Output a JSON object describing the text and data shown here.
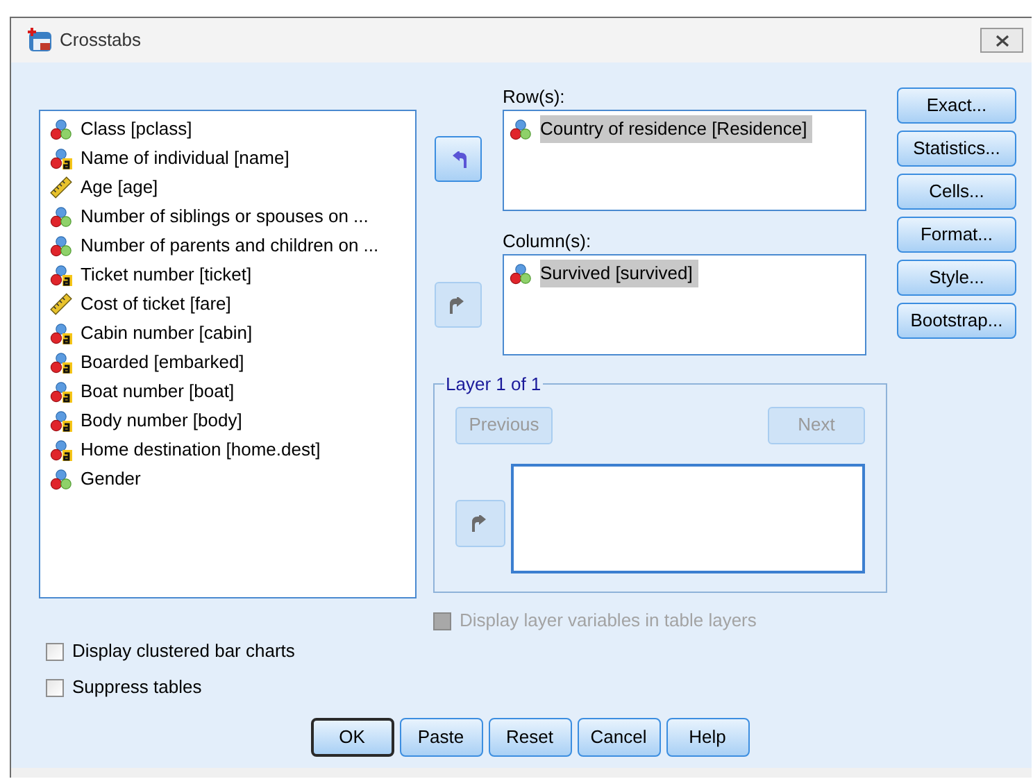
{
  "window": {
    "title": "Crosstabs"
  },
  "variables": [
    {
      "label": "Class [pclass]",
      "kind": "nominal"
    },
    {
      "label": "Name of individual [name]",
      "kind": "string"
    },
    {
      "label": "Age [age]",
      "kind": "scale"
    },
    {
      "label": "Number of siblings or spouses on ...",
      "kind": "nominal"
    },
    {
      "label": "Number of parents and children on ...",
      "kind": "nominal"
    },
    {
      "label": "Ticket number [ticket]",
      "kind": "string"
    },
    {
      "label": "Cost of ticket [fare]",
      "kind": "scale"
    },
    {
      "label": "Cabin number [cabin]",
      "kind": "string"
    },
    {
      "label": "Boarded [embarked]",
      "kind": "string"
    },
    {
      "label": "Boat number [boat]",
      "kind": "string"
    },
    {
      "label": "Body number [body]",
      "kind": "string"
    },
    {
      "label": "Home destination [home.dest]",
      "kind": "string"
    },
    {
      "label": "Gender",
      "kind": "nominal"
    }
  ],
  "targets": [
    {
      "label": "Row(s):",
      "move_disabled": false,
      "items": [
        {
          "label": "Country of residence [Residence]",
          "kind": "nominal",
          "selected": true
        }
      ]
    },
    {
      "label": "Column(s):",
      "move_disabled": true,
      "items": [
        {
          "label": "Survived [survived]",
          "kind": "nominal",
          "selected": true
        }
      ]
    }
  ],
  "layer": {
    "title": "Layer 1 of 1",
    "previous": {
      "label": "Previous",
      "disabled": true
    },
    "next": {
      "label": "Next",
      "disabled": true
    },
    "move_disabled": true
  },
  "layer_option": {
    "label": "Display layer variables in table layers",
    "checked": false,
    "disabled": true
  },
  "options": [
    {
      "label": "Display clustered bar charts",
      "checked": false,
      "disabled": false
    },
    {
      "label": "Suppress tables",
      "checked": false,
      "disabled": false
    }
  ],
  "side_buttons": [
    {
      "label": "Exact..."
    },
    {
      "label": "Statistics..."
    },
    {
      "label": "Cells..."
    },
    {
      "label": "Format..."
    },
    {
      "label": "Style..."
    },
    {
      "label": "Bootstrap..."
    }
  ],
  "dialog_buttons": [
    {
      "label": "OK",
      "default": true
    },
    {
      "label": "Paste",
      "default": false
    },
    {
      "label": "Reset",
      "default": false
    },
    {
      "label": "Cancel",
      "default": false
    },
    {
      "label": "Help",
      "default": false
    }
  ]
}
